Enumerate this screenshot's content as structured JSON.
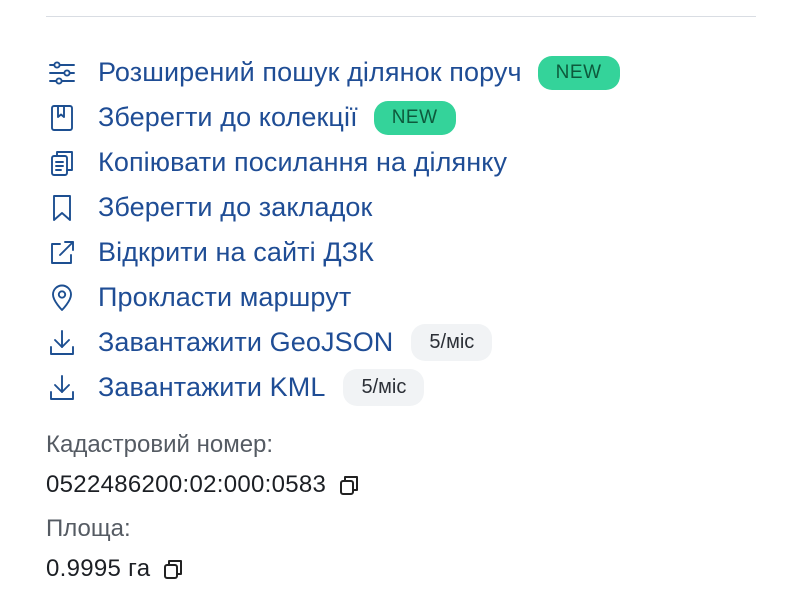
{
  "actions": [
    {
      "icon": "sliders-icon",
      "label": "Розширений пошук ділянок поруч",
      "badge": "NEW",
      "badge_type": "new"
    },
    {
      "icon": "book-icon",
      "label": "Зберегти до колекції",
      "badge": "NEW",
      "badge_type": "new"
    },
    {
      "icon": "copy-link-icon",
      "label": "Копіювати посилання на ділянку",
      "badge": "",
      "badge_type": ""
    },
    {
      "icon": "bookmark-icon",
      "label": "Зберегти до закладок",
      "badge": "",
      "badge_type": ""
    },
    {
      "icon": "external-link-icon",
      "label": "Відкрити на сайті ДЗК",
      "badge": "",
      "badge_type": ""
    },
    {
      "icon": "map-pin-icon",
      "label": "Прокласти маршрут",
      "badge": "",
      "badge_type": ""
    },
    {
      "icon": "download-icon",
      "label": "Завантажити GeoJSON",
      "badge": "5/міс",
      "badge_type": "quota"
    },
    {
      "icon": "download-icon",
      "label": "Завантажити KML",
      "badge": "5/міс",
      "badge_type": "quota"
    }
  ],
  "info": {
    "cadastral_label": "Кадастровий номер:",
    "cadastral_value": "0522486200:02:000:0583",
    "area_label": "Площа:",
    "area_value": "0.9995 га"
  },
  "colors": {
    "action_text": "#1f4d95",
    "new_badge_bg": "#34d39a",
    "quota_badge_bg": "#f1f3f5"
  }
}
